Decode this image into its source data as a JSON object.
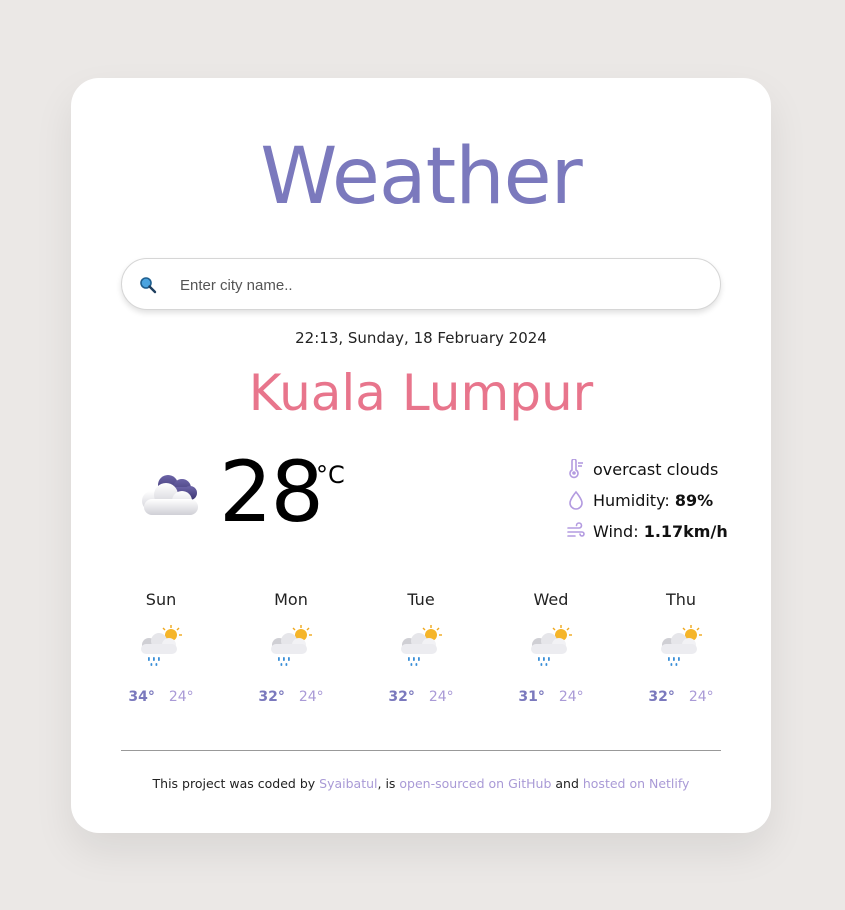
{
  "app": {
    "title": "Weather"
  },
  "search": {
    "placeholder": "Enter city name..",
    "icon": "search-icon"
  },
  "current": {
    "datetime": "22:13, Sunday, 18 February 2024",
    "city": "Kuala Lumpur",
    "temperature": "28",
    "unit": "°C",
    "icon": "cloud-icon",
    "description": "overcast clouds",
    "humidity_label": "Humidity: ",
    "humidity_value": "89%",
    "wind_label": "Wind: ",
    "wind_value": "1.17km/h"
  },
  "forecast": [
    {
      "day": "Sun",
      "high": "34°",
      "low": "24°",
      "icon": "rain-sun-icon"
    },
    {
      "day": "Mon",
      "high": "32°",
      "low": "24°",
      "icon": "rain-sun-icon"
    },
    {
      "day": "Tue",
      "high": "32°",
      "low": "24°",
      "icon": "rain-sun-icon"
    },
    {
      "day": "Wed",
      "high": "31°",
      "low": "24°",
      "icon": "rain-sun-icon"
    },
    {
      "day": "Thu",
      "high": "32°",
      "low": "24°",
      "icon": "rain-sun-icon"
    }
  ],
  "footer": {
    "text1": "This project was coded by ",
    "author": "Syaibatul",
    "text2": ", is ",
    "github": "open-sourced on GitHub",
    "text3": " and ",
    "netlify": "hosted on Netlify"
  },
  "colors": {
    "accent": "#7b79bd",
    "city": "#e8758c",
    "link": "#a99ad6",
    "background": "#ebe8e6"
  }
}
